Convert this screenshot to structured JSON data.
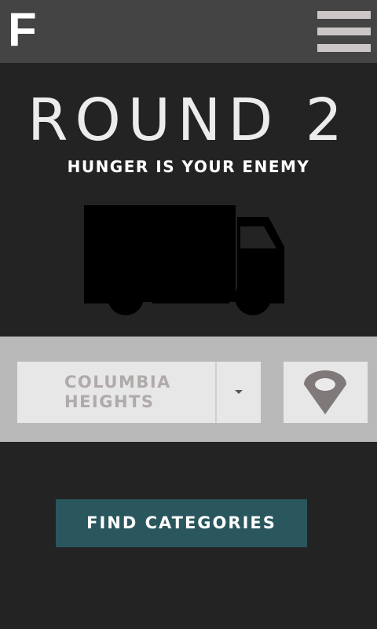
{
  "header": {
    "logo": "F",
    "menu_icon": "hamburger-menu-icon"
  },
  "hero": {
    "title": "ROUND 2",
    "subtitle": "HUNGER IS YOUR ENEMY",
    "icon": "truck-icon"
  },
  "location": {
    "selected_neighborhood": "COLUMBIA HEIGHTS",
    "dropdown_icon": "caret-down-icon",
    "locate_icon": "map-pin-icon"
  },
  "actions": {
    "find_label": "FIND CATEGORIES"
  },
  "colors": {
    "header_bg": "#444444",
    "page_bg": "#232323",
    "band_bg": "#b9b9b9",
    "button_bg": "#2a575e",
    "pin": "#7f7979"
  }
}
